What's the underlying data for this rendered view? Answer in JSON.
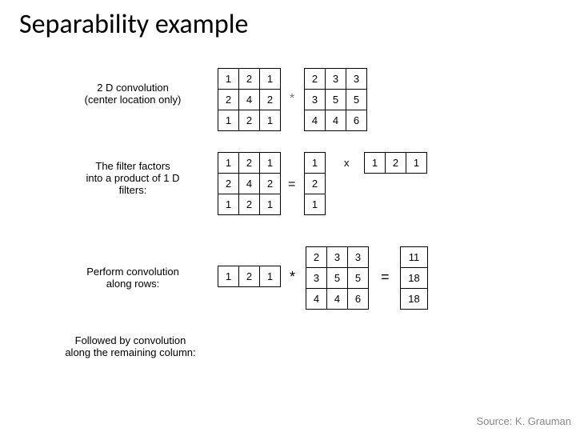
{
  "title": "Separability example",
  "labels": {
    "l1a": "2 D convolution",
    "l1b": "(center location only)",
    "l2a": "The filter factors",
    "l2b": "into a product of 1 D",
    "l2c": "filters:",
    "l3a": "Perform convolution",
    "l3b": "along rows:",
    "l4a": "Followed by convolution",
    "l4b": "along the remaining column:"
  },
  "ops": {
    "asterisk1": "*",
    "equals1": "=",
    "times": "x",
    "asterisk2": "*",
    "equals2": "="
  },
  "grids": {
    "k3a": [
      [
        "1",
        "2",
        "1"
      ],
      [
        "2",
        "4",
        "2"
      ],
      [
        "1",
        "2",
        "1"
      ]
    ],
    "img": [
      [
        "2",
        "3",
        "3"
      ],
      [
        "3",
        "5",
        "5"
      ],
      [
        "4",
        "4",
        "6"
      ]
    ],
    "k3b": [
      [
        "1",
        "2",
        "1"
      ],
      [
        "2",
        "4",
        "2"
      ],
      [
        "1",
        "2",
        "1"
      ]
    ],
    "col1": [
      [
        "1"
      ],
      [
        "2"
      ],
      [
        "1"
      ]
    ],
    "row1": [
      [
        "1",
        "2",
        "1"
      ]
    ],
    "row2": [
      [
        "1",
        "2",
        "1"
      ]
    ],
    "img2": [
      [
        "2",
        "3",
        "3"
      ],
      [
        "3",
        "5",
        "5"
      ],
      [
        "4",
        "4",
        "6"
      ]
    ],
    "res": [
      [
        "11"
      ],
      [
        "18"
      ],
      [
        "18"
      ]
    ]
  },
  "source": "Source: K. Grauman"
}
